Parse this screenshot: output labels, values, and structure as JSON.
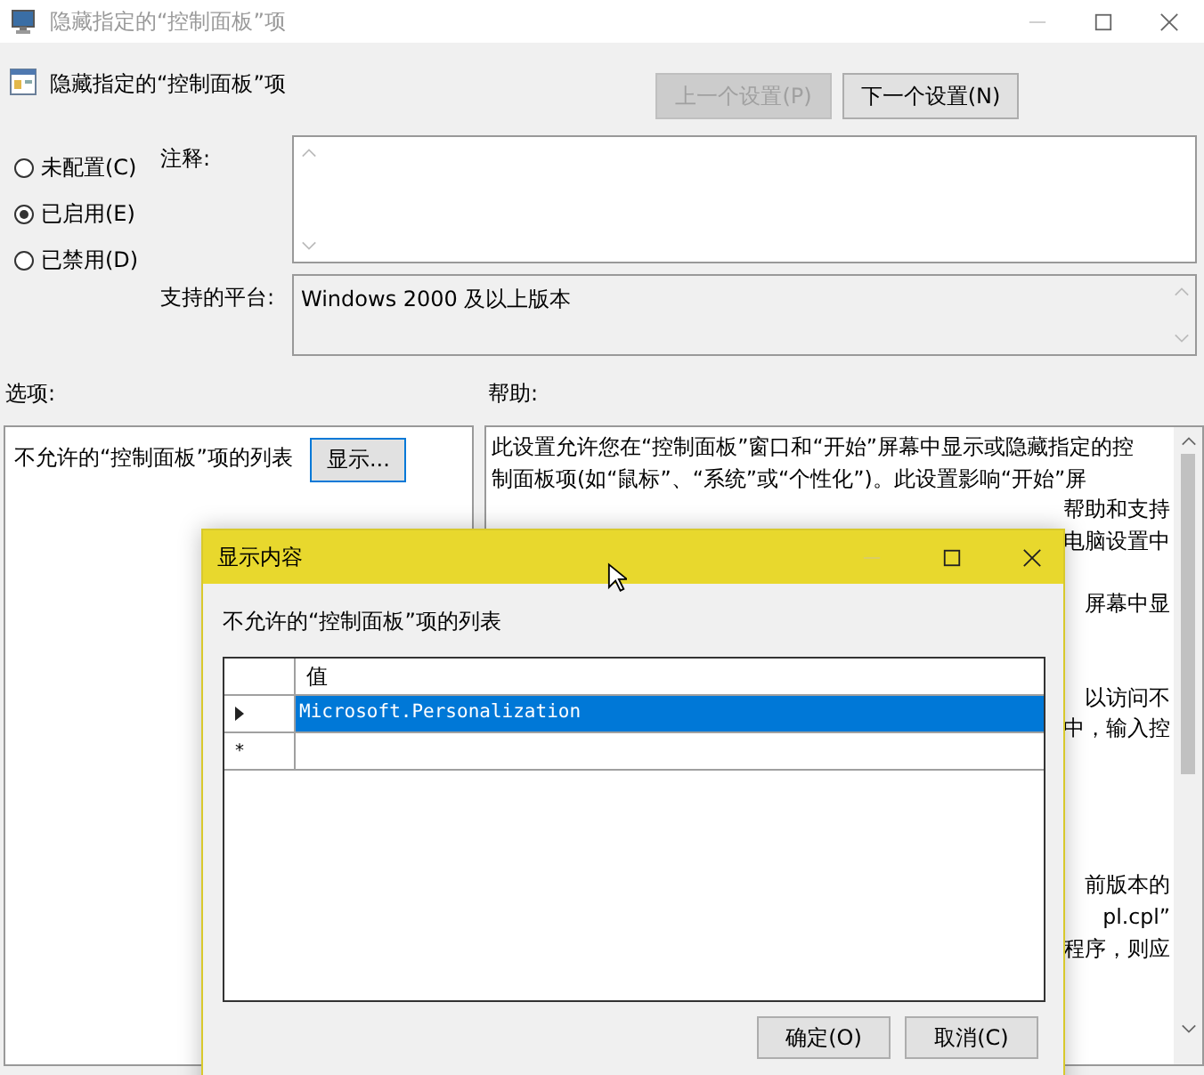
{
  "window": {
    "title": "隐藏指定的“控制面板”项"
  },
  "header": {
    "title": "隐藏指定的“控制面板”项",
    "buttons": [
      {
        "label": "上一个设置(P)",
        "disabled": true
      },
      {
        "label": "下一个设置(N)",
        "disabled": false
      }
    ]
  },
  "state_options": [
    {
      "label": "未配置(C)",
      "selected": false
    },
    {
      "label": "已启用(E)",
      "selected": true
    },
    {
      "label": "已禁用(D)",
      "selected": false
    }
  ],
  "comment": {
    "label": "注释:"
  },
  "platform": {
    "label": "支持的平台:",
    "value": "Windows 2000 及以上版本"
  },
  "options": {
    "label": "选项:",
    "item_label": "不允许的“控制面板”项的列表",
    "button": "显示..."
  },
  "help": {
    "label": "帮助:",
    "lines": [
      {
        "kind": "full",
        "text": "此设置允许您在“控制面板”窗口和“开始”屏幕中显示或隐藏指定的控"
      },
      {
        "kind": "full",
        "text": "制面板项(如“鼠标”、“系统”或“个性化”)。此设置影响“开始”屏"
      },
      {
        "kind": "tail",
        "text": "帮助和支持"
      },
      {
        "kind": "tail",
        "text": "电脑设置中"
      },
      {
        "kind": "covered"
      },
      {
        "kind": "tail",
        "text": "屏幕中显"
      },
      {
        "kind": "covered"
      },
      {
        "kind": "covered"
      },
      {
        "kind": "tail",
        "text": "以访问不"
      },
      {
        "kind": "tail",
        "text": "中，输入控"
      },
      {
        "kind": "covered"
      },
      {
        "kind": "covered"
      },
      {
        "kind": "covered"
      },
      {
        "kind": "covered"
      },
      {
        "kind": "tail",
        "text": "前版本的"
      },
      {
        "kind": "tail",
        "text": "pl.cpl”"
      },
      {
        "kind": "tail",
        "text": "程序，则应"
      }
    ]
  },
  "dialog": {
    "title": "显示内容",
    "label": "不允许的“控制面板”项的列表",
    "columns": [
      "值"
    ],
    "rows": [
      {
        "kind": "current",
        "value": "Microsoft.Personalization",
        "selected": true
      },
      {
        "kind": "new",
        "marker": "*",
        "selected": false
      }
    ],
    "buttons": [
      "确定(O)",
      "取消(C)"
    ]
  }
}
